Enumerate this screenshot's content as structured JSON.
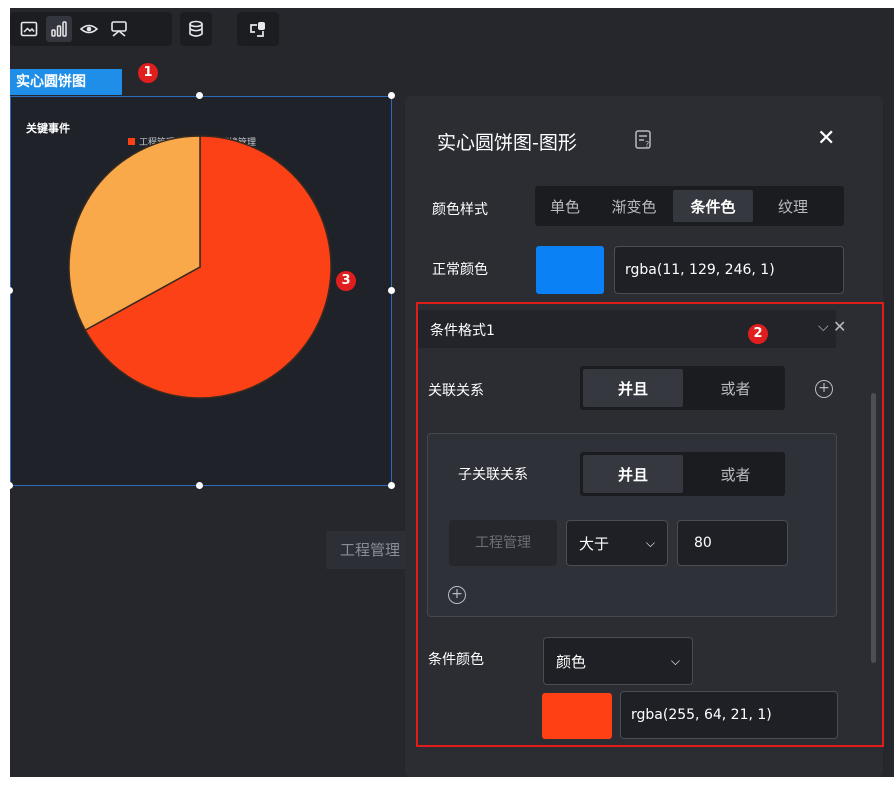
{
  "toolbar": {
    "icons": [
      "image-icon",
      "bar-chart-icon",
      "eye-icon",
      "comment-icon",
      "database-icon",
      "link-icon"
    ]
  },
  "component": {
    "tag_label": "实心圆饼图"
  },
  "markers": {
    "m1": "1",
    "m2": "2",
    "m3": "3"
  },
  "chart_data": {
    "type": "pie",
    "title": "关键事件",
    "categories": [
      "工程管理",
      "环境管理"
    ],
    "values": [
      67,
      33
    ],
    "colors": [
      "#fc4116",
      "#f9a94a"
    ],
    "legend_position": "top"
  },
  "tooltip": {
    "text": "工程管理"
  },
  "panel": {
    "title": "实心圆饼图-图形",
    "close": "✕",
    "color_style_label": "颜色样式",
    "color_style_options": [
      "单色",
      "渐变色",
      "条件色",
      "纹理"
    ],
    "color_style_selected": "条件色",
    "normal_color_label": "正常颜色",
    "normal_color_value": "rgba(11, 129, 246, 1)",
    "normal_color_hex": "#0b81f6",
    "condition": {
      "header": "条件格式1",
      "relation_label": "关联关系",
      "relation_options": [
        "并且",
        "或者"
      ],
      "sub_relation_label": "子关联关系",
      "sub_relation_options": [
        "并且",
        "或者"
      ],
      "field_placeholder": "工程管理",
      "operator": "大于",
      "threshold": "80",
      "color_label": "条件颜色",
      "color_type": "颜色",
      "color_value": "rgba(255, 64, 21, 1)",
      "color_hex": "#ff4015"
    }
  }
}
